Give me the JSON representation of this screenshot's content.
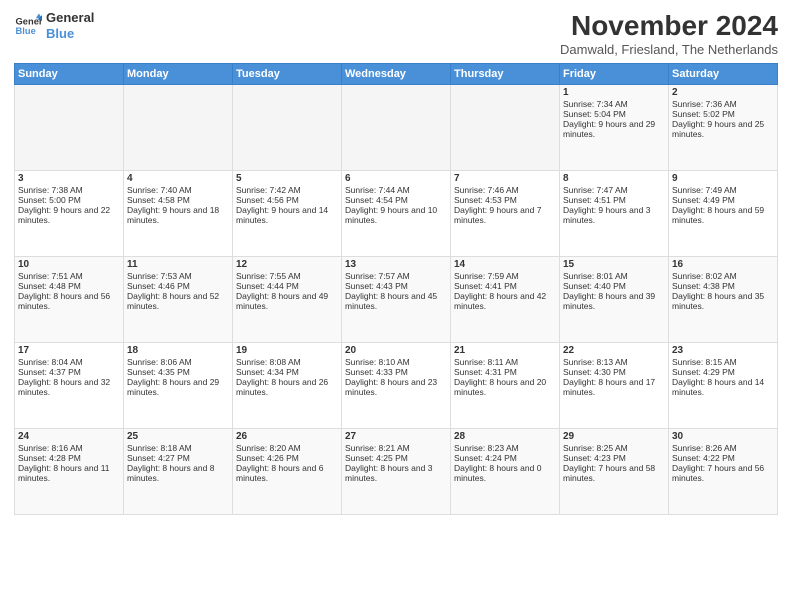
{
  "logo": {
    "line1": "General",
    "line2": "Blue"
  },
  "title": "November 2024",
  "subtitle": "Damwald, Friesland, The Netherlands",
  "headers": [
    "Sunday",
    "Monday",
    "Tuesday",
    "Wednesday",
    "Thursday",
    "Friday",
    "Saturday"
  ],
  "weeks": [
    [
      {
        "day": "",
        "empty": true
      },
      {
        "day": "",
        "empty": true
      },
      {
        "day": "",
        "empty": true
      },
      {
        "day": "",
        "empty": true
      },
      {
        "day": "",
        "empty": true
      },
      {
        "day": "1",
        "rise": "7:34 AM",
        "set": "5:04 PM",
        "daylight": "9 hours and 29 minutes."
      },
      {
        "day": "2",
        "rise": "7:36 AM",
        "set": "5:02 PM",
        "daylight": "9 hours and 25 minutes."
      }
    ],
    [
      {
        "day": "3",
        "rise": "7:38 AM",
        "set": "5:00 PM",
        "daylight": "9 hours and 22 minutes."
      },
      {
        "day": "4",
        "rise": "7:40 AM",
        "set": "4:58 PM",
        "daylight": "9 hours and 18 minutes."
      },
      {
        "day": "5",
        "rise": "7:42 AM",
        "set": "4:56 PM",
        "daylight": "9 hours and 14 minutes."
      },
      {
        "day": "6",
        "rise": "7:44 AM",
        "set": "4:54 PM",
        "daylight": "9 hours and 10 minutes."
      },
      {
        "day": "7",
        "rise": "7:46 AM",
        "set": "4:53 PM",
        "daylight": "9 hours and 7 minutes."
      },
      {
        "day": "8",
        "rise": "7:47 AM",
        "set": "4:51 PM",
        "daylight": "9 hours and 3 minutes."
      },
      {
        "day": "9",
        "rise": "7:49 AM",
        "set": "4:49 PM",
        "daylight": "8 hours and 59 minutes."
      }
    ],
    [
      {
        "day": "10",
        "rise": "7:51 AM",
        "set": "4:48 PM",
        "daylight": "8 hours and 56 minutes."
      },
      {
        "day": "11",
        "rise": "7:53 AM",
        "set": "4:46 PM",
        "daylight": "8 hours and 52 minutes."
      },
      {
        "day": "12",
        "rise": "7:55 AM",
        "set": "4:44 PM",
        "daylight": "8 hours and 49 minutes."
      },
      {
        "day": "13",
        "rise": "7:57 AM",
        "set": "4:43 PM",
        "daylight": "8 hours and 45 minutes."
      },
      {
        "day": "14",
        "rise": "7:59 AM",
        "set": "4:41 PM",
        "daylight": "8 hours and 42 minutes."
      },
      {
        "day": "15",
        "rise": "8:01 AM",
        "set": "4:40 PM",
        "daylight": "8 hours and 39 minutes."
      },
      {
        "day": "16",
        "rise": "8:02 AM",
        "set": "4:38 PM",
        "daylight": "8 hours and 35 minutes."
      }
    ],
    [
      {
        "day": "17",
        "rise": "8:04 AM",
        "set": "4:37 PM",
        "daylight": "8 hours and 32 minutes."
      },
      {
        "day": "18",
        "rise": "8:06 AM",
        "set": "4:35 PM",
        "daylight": "8 hours and 29 minutes."
      },
      {
        "day": "19",
        "rise": "8:08 AM",
        "set": "4:34 PM",
        "daylight": "8 hours and 26 minutes."
      },
      {
        "day": "20",
        "rise": "8:10 AM",
        "set": "4:33 PM",
        "daylight": "8 hours and 23 minutes."
      },
      {
        "day": "21",
        "rise": "8:11 AM",
        "set": "4:31 PM",
        "daylight": "8 hours and 20 minutes."
      },
      {
        "day": "22",
        "rise": "8:13 AM",
        "set": "4:30 PM",
        "daylight": "8 hours and 17 minutes."
      },
      {
        "day": "23",
        "rise": "8:15 AM",
        "set": "4:29 PM",
        "daylight": "8 hours and 14 minutes."
      }
    ],
    [
      {
        "day": "24",
        "rise": "8:16 AM",
        "set": "4:28 PM",
        "daylight": "8 hours and 11 minutes."
      },
      {
        "day": "25",
        "rise": "8:18 AM",
        "set": "4:27 PM",
        "daylight": "8 hours and 8 minutes."
      },
      {
        "day": "26",
        "rise": "8:20 AM",
        "set": "4:26 PM",
        "daylight": "8 hours and 6 minutes."
      },
      {
        "day": "27",
        "rise": "8:21 AM",
        "set": "4:25 PM",
        "daylight": "8 hours and 3 minutes."
      },
      {
        "day": "28",
        "rise": "8:23 AM",
        "set": "4:24 PM",
        "daylight": "8 hours and 0 minutes."
      },
      {
        "day": "29",
        "rise": "8:25 AM",
        "set": "4:23 PM",
        "daylight": "7 hours and 58 minutes."
      },
      {
        "day": "30",
        "rise": "8:26 AM",
        "set": "4:22 PM",
        "daylight": "7 hours and 56 minutes."
      }
    ]
  ]
}
